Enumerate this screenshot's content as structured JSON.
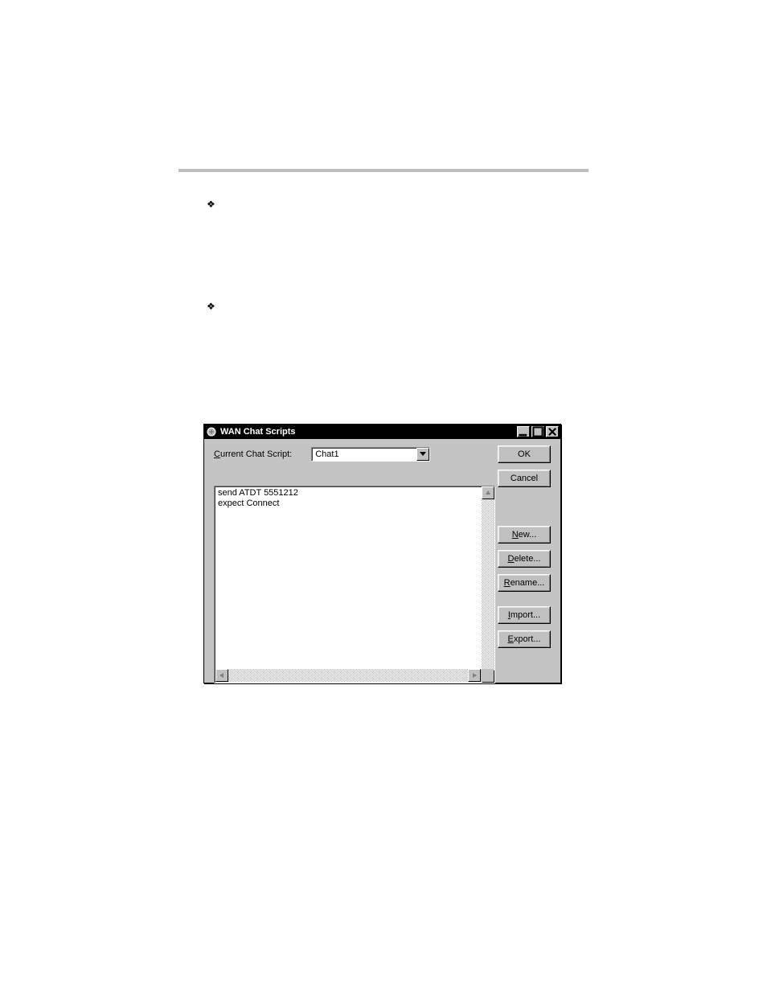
{
  "bullets": {
    "glyph": "❖"
  },
  "dialog": {
    "title": "WAN Chat Scripts",
    "currentLabel": "Current Chat Script:",
    "currentValue": "Chat1",
    "scriptBody": "send ATDT 5551212\nexpect Connect",
    "buttons": {
      "ok": "OK",
      "cancel": "Cancel",
      "new": "New...",
      "delete": "Delete...",
      "rename": "Rename...",
      "import": "Import...",
      "export": "Export..."
    }
  }
}
